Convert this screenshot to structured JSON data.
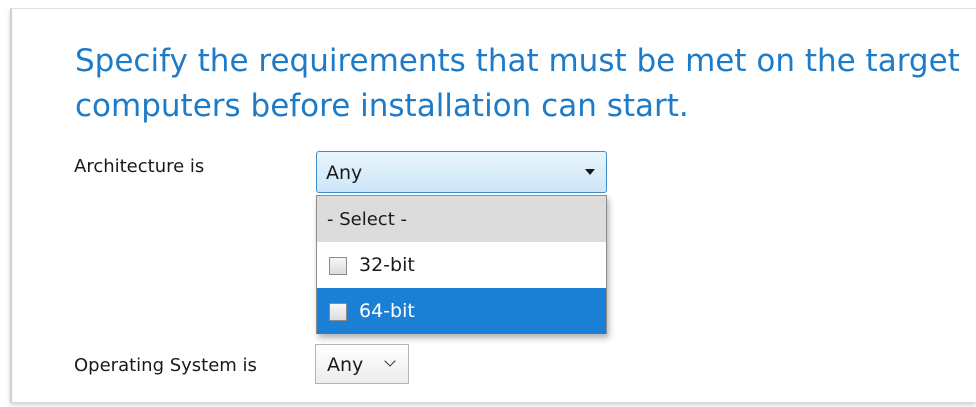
{
  "heading": {
    "line1": "Specify the requirements that must be met on the target",
    "line2": "computers before installation can start."
  },
  "architecture": {
    "label": "Architecture is",
    "selected_value": "Any",
    "dropdown": {
      "header": "- Select -",
      "options": [
        {
          "label": "32-bit",
          "checked": false,
          "highlighted": false
        },
        {
          "label": "64-bit",
          "checked": false,
          "highlighted": true
        }
      ]
    }
  },
  "operating_system": {
    "label": "Operating System is",
    "selected_value": "Any"
  },
  "colors": {
    "heading": "#1e7bc8",
    "highlight": "#1b7fd5",
    "combo_border_active": "#3d8ec9"
  },
  "icons": {
    "combo_open_arrow": "triangle-down-icon",
    "combo_closed_arrow": "chevron-down-icon"
  }
}
